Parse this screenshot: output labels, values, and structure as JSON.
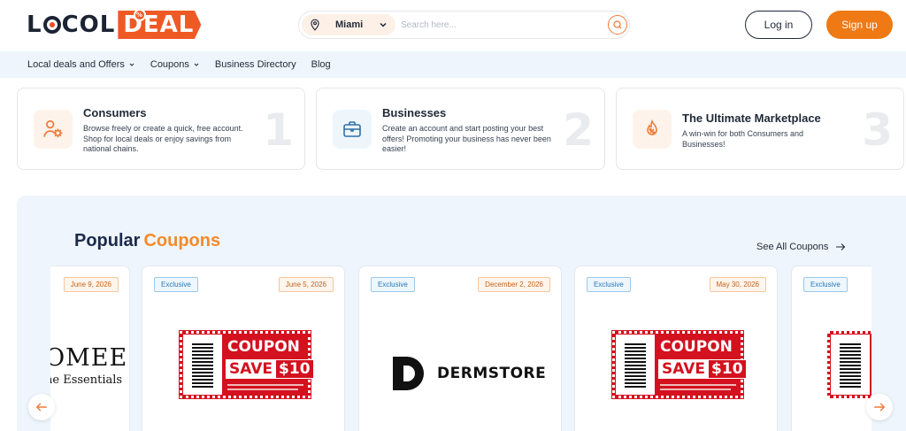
{
  "brand": {
    "part1": "LOCOL",
    "part2": "DEAL"
  },
  "search": {
    "city": "Miami",
    "placeholder": "Search here..."
  },
  "auth": {
    "login": "Log in",
    "signup": "Sign up"
  },
  "nav": [
    {
      "label": "Local deals and Offers",
      "dropdown": true
    },
    {
      "label": "Coupons",
      "dropdown": true
    },
    {
      "label": "Business Directory",
      "dropdown": false
    },
    {
      "label": "Blog",
      "dropdown": false
    }
  ],
  "features": [
    {
      "title": "Consumers",
      "desc": "Browse freely or create a quick, free account. Shop for local deals or enjoy savings from national chains.",
      "num": "1",
      "icon": "users-gear-icon"
    },
    {
      "title": "Businesses",
      "desc": "Create an account and start posting your best offers! Promoting your business has never been easier!",
      "num": "2",
      "icon": "briefcase-icon"
    },
    {
      "title": "The Ultimate Marketplace",
      "desc": "A win-win for both Consumers and Businesses!",
      "num": "3",
      "icon": "discount-fire-icon"
    }
  ],
  "coupons": {
    "title_main": "Popular",
    "title_accent": "Coupons",
    "see_all": "See All Coupons",
    "cards": [
      {
        "exclusive": "",
        "date": "June 9, 2026",
        "brand_text_1": "OMEE",
        "brand_text_2": "ne Essentials"
      },
      {
        "exclusive": "Exclusive",
        "date": "June 5, 2026",
        "coupon": "COUPON",
        "save": "SAVE",
        "amount": "$10"
      },
      {
        "exclusive": "Exclusive",
        "date": "December 2, 2026",
        "brand_text_1": "DERMSTORE"
      },
      {
        "exclusive": "Exclusive",
        "date": "May 30, 2026",
        "coupon": "COUPON",
        "save": "SAVE",
        "amount": "$10"
      },
      {
        "exclusive": "Exclusive",
        "date": ""
      }
    ]
  },
  "colors": {
    "accent": "#ef7914",
    "brand_red": "#d4111f",
    "nav_bg": "#eef5fc"
  }
}
